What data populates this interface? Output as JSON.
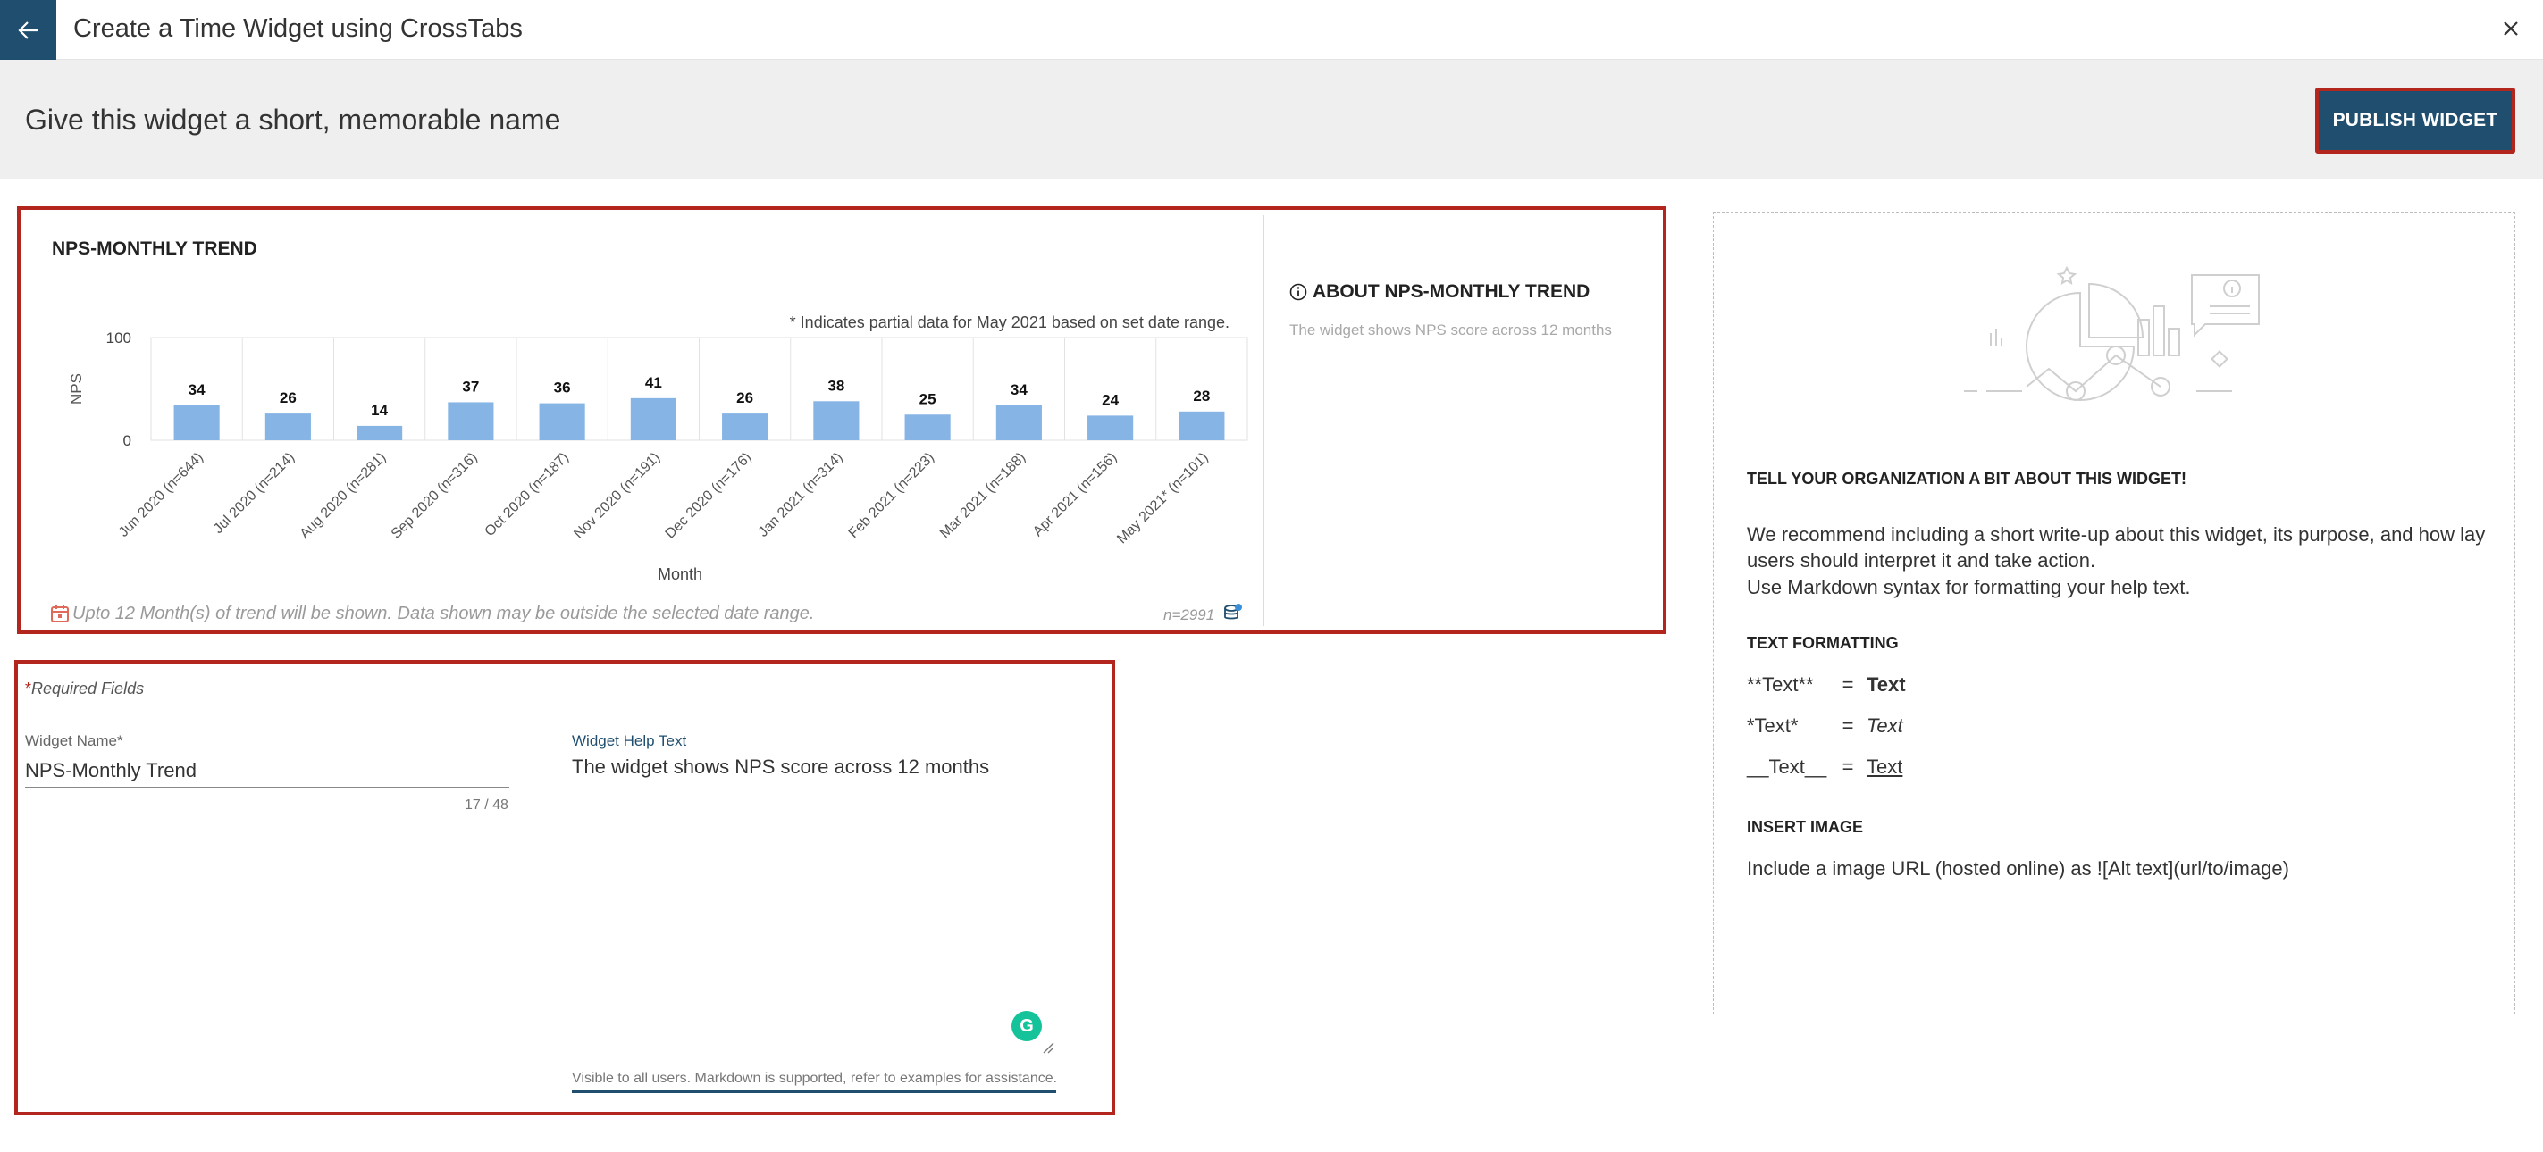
{
  "topbar": {
    "title": "Create a Time Widget using CrossTabs"
  },
  "header": {
    "name_prompt": "Give this widget a short, memorable name",
    "publish_label": "PUBLISH WIDGET"
  },
  "preview": {
    "chart_title": "NPS-MONTHLY TREND",
    "partial_note": "* Indicates partial data for May 2021 based on set date range.",
    "footer_note": "Upto 12 Month(s) of trend will be shown. Data shown may be outside the selected date range.",
    "n_count": "n=2991",
    "about_title": "ABOUT NPS-MONTHLY TREND",
    "about_text": "The widget shows NPS score across 12 months"
  },
  "chart_data": {
    "type": "bar",
    "title": "NPS-MONTHLY TREND",
    "xlabel": "Month",
    "ylabel": "NPS",
    "ylim": [
      0,
      100
    ],
    "ytick_labels": [
      "100",
      "0"
    ],
    "categories": [
      "Jun 2020 (n=644)",
      "Jul 2020 (n=214)",
      "Aug 2020 (n=281)",
      "Sep 2020 (n=316)",
      "Oct 2020 (n=187)",
      "Nov 2020 (n=191)",
      "Dec 2020 (n=176)",
      "Jan 2021 (n=314)",
      "Feb 2021 (n=223)",
      "Mar 2021 (n=188)",
      "Apr 2021 (n=156)",
      "May 2021* (n=101)"
    ],
    "values": [
      34,
      26,
      14,
      37,
      36,
      41,
      26,
      38,
      25,
      34,
      24,
      28
    ],
    "color": "#85b4e5",
    "grid": true,
    "legend": "none"
  },
  "form": {
    "required_star": "*",
    "required_text": "Required Fields",
    "name_label": "Widget Name*",
    "name_value": "NPS-Monthly Trend",
    "char_count": "17 / 48",
    "help_label": "Widget Help Text",
    "help_value": "The widget shows NPS score across 12 months",
    "help_hint": "Visible to all users. Markdown is supported, refer to examples for assistance."
  },
  "help_panel": {
    "heading": "TELL YOUR ORGANIZATION A BIT ABOUT THIS WIDGET!",
    "para1": "We recommend including a short write-up about this widget, its purpose, and how lay users should interpret it and take action.",
    "para2": "Use Markdown syntax for formatting your help text.",
    "formatting_heading": "TEXT FORMATTING",
    "rows": [
      {
        "syntax": "**Text**",
        "eq": "=",
        "result": "Text"
      },
      {
        "syntax": "*Text*",
        "eq": "=",
        "result": "Text"
      },
      {
        "syntax": "__Text__",
        "eq": "=",
        "result": "Text"
      }
    ],
    "image_heading": "INSERT IMAGE",
    "image_text": "Include a image URL (hosted online) as ![Alt text](url/to/image)"
  },
  "colors": {
    "primary": "#1f4e6e",
    "highlight_border": "#b3261e",
    "bar": "#85b4e5",
    "band": "#efefef"
  }
}
